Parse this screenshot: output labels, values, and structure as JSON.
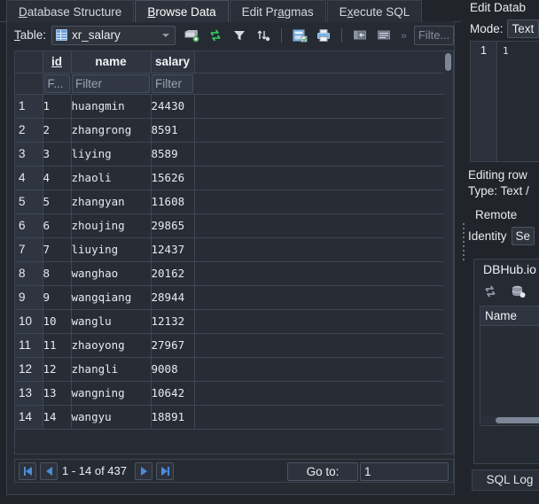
{
  "tabs": [
    {
      "label": "Database Structure",
      "mnemonic": "D",
      "active": false
    },
    {
      "label": "Browse Data",
      "mnemonic": "B",
      "active": true
    },
    {
      "label": "Edit Pragmas",
      "mnemonic": "a",
      "active": false
    },
    {
      "label": "Execute SQL",
      "mnemonic": "x",
      "active": false
    }
  ],
  "toolbar": {
    "table_label": "Table:",
    "table_label_mnemonic": "T",
    "selected_table": "xr_salary",
    "table_icon": "table-icon",
    "icons": [
      "new-record-icon",
      "refresh-icon",
      "filter-icon",
      "sort-icon",
      "save-results-icon",
      "print-icon",
      "insert-column-icon",
      "conditional-format-icon",
      "overflow-chevron-icon"
    ],
    "filter_placeholder": "Filte..."
  },
  "grid": {
    "columns": [
      "id",
      "name",
      "salary"
    ],
    "sorted_column": "id",
    "filter_placeholders": {
      "rowhdr": "F...",
      "id": "Filter",
      "name": "Filter",
      "salary": "Filter"
    },
    "rows": [
      {
        "n": "1",
        "id": "1",
        "name": "huangmin",
        "salary": "24430"
      },
      {
        "n": "2",
        "id": "2",
        "name": "zhangrong",
        "salary": "8591"
      },
      {
        "n": "3",
        "id": "3",
        "name": "liying",
        "salary": "8589"
      },
      {
        "n": "4",
        "id": "4",
        "name": "zhaoli",
        "salary": "15626"
      },
      {
        "n": "5",
        "id": "5",
        "name": "zhangyan",
        "salary": "11608"
      },
      {
        "n": "6",
        "id": "6",
        "name": "zhoujing",
        "salary": "29865"
      },
      {
        "n": "7",
        "id": "7",
        "name": "liuying",
        "salary": "12437"
      },
      {
        "n": "8",
        "id": "8",
        "name": "wanghao",
        "salary": "20162"
      },
      {
        "n": "9",
        "id": "9",
        "name": "wangqiang",
        "salary": "28944"
      },
      {
        "n": "10",
        "id": "10",
        "name": "wanglu",
        "salary": "12132"
      },
      {
        "n": "11",
        "id": "11",
        "name": "zhaoyong",
        "salary": "27967"
      },
      {
        "n": "12",
        "id": "12",
        "name": "zhangli",
        "salary": "9008"
      },
      {
        "n": "13",
        "id": "13",
        "name": "wangning",
        "salary": "10642"
      },
      {
        "n": "14",
        "id": "14",
        "name": "wangyu",
        "salary": "18891"
      }
    ]
  },
  "pager": {
    "first_icon": "first-page-icon",
    "prev_icon": "previous-page-icon",
    "next_icon": "next-page-icon",
    "last_icon": "last-page-icon",
    "range_text": "1 - 14 of 437",
    "goto_label": "Go to:",
    "goto_value": "1"
  },
  "right": {
    "edit_database_title": "Edit Datab",
    "mode_label": "Mode:",
    "mode_value": "Text",
    "editor_line_number": "1",
    "editor_content": "1",
    "status_editing": "Editing row",
    "status_type": "Type: Text /",
    "remote_title": "Remote",
    "identity_label": "Identity",
    "identity_value": "Se",
    "dbhub": {
      "title": "DBHub.io",
      "tools": [
        "refresh-icon",
        "database-icon"
      ],
      "list_header": "Name",
      "list_items": []
    },
    "sql_log_tab": "SQL Log"
  },
  "colors": {
    "window_bg": "#21252b",
    "panel_bg": "#262b33",
    "grid_bg": "#272c35",
    "header_bg": "#2e3440",
    "border": "#3b4350",
    "text": "#e8ebef",
    "accent_blue": "#4a8ddc",
    "muted_text": "#9aa2af"
  }
}
